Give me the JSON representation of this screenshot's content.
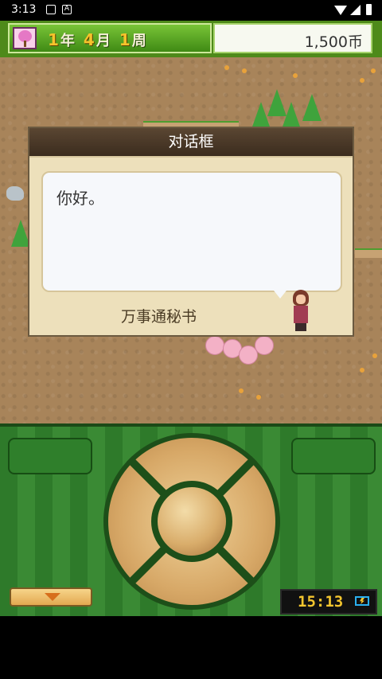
{
  "status_bar": {
    "time": "3:13"
  },
  "hud": {
    "year_num": "1",
    "year_unit": "年",
    "month_num": "4",
    "month_unit": "月",
    "week_num": "1",
    "week_unit": "周",
    "money": "1,500币"
  },
  "dialog": {
    "title": "对话框",
    "message": "你好。",
    "speaker": "万事通秘书"
  },
  "controls": {
    "clock": "15:13"
  }
}
